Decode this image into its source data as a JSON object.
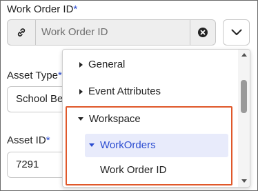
{
  "work_order": {
    "label": "Work Order ID",
    "required_mark": "*",
    "placeholder": "Work Order ID",
    "link_icon": "link-icon",
    "clear_icon": "clear-circle-x-icon",
    "toggle_icon": "chevron-down-icon"
  },
  "asset_type": {
    "label": "Asset Type",
    "required_mark": "*",
    "value": "School Bea"
  },
  "asset_id": {
    "label": "Asset ID",
    "required_mark": "*",
    "value": "7291"
  },
  "dropdown": {
    "items": [
      {
        "label": "General",
        "state": "collapsed"
      },
      {
        "label": "Event Attributes",
        "state": "collapsed"
      },
      {
        "label": "Workspace",
        "state": "expanded"
      },
      {
        "label": "WorkOrders",
        "state": "expanded-selected"
      },
      {
        "label": "Work Order ID",
        "state": "leaf"
      }
    ]
  },
  "colors": {
    "accent": "#2a4bd0",
    "highlight_border": "#e0582a",
    "selected_bg": "#e8ebfb"
  }
}
